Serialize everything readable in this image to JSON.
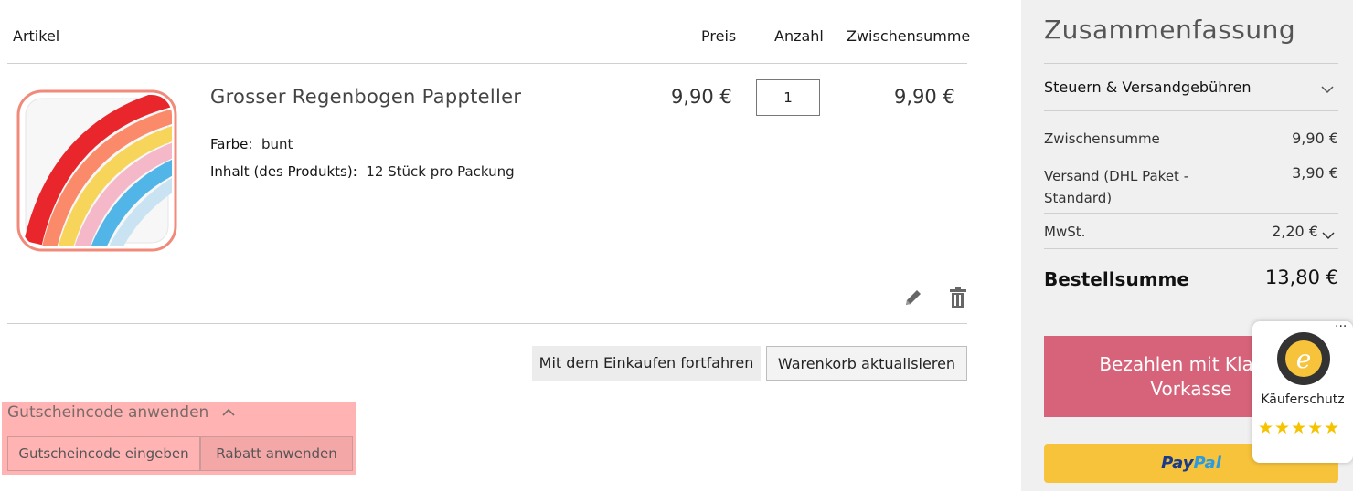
{
  "cart": {
    "headers": {
      "item": "Artikel",
      "price": "Preis",
      "qty": "Anzahl",
      "subtotal": "Zwischensumme"
    },
    "item": {
      "name": "Grosser Regenbogen Pappteller",
      "option1_label": "Farbe:",
      "option1_value": "bunt",
      "option2_label": "Inhalt (des Produkts):",
      "option2_value": "12 Stück pro Packung",
      "price": "9,90 €",
      "qty": "1",
      "subtotal": "9,90 €"
    },
    "continue_label": "Mit dem Einkaufen fortfahren",
    "update_label": "Warenkorb aktualisieren"
  },
  "coupon": {
    "title": "Gutscheincode anwenden",
    "input_placeholder": "Gutscheincode eingeben",
    "apply_label": "Rabatt anwenden"
  },
  "summary": {
    "title": "Zusammenfassung",
    "taxes_label": "Steuern & Versandgebühren",
    "subtotal_label": "Zwischensumme",
    "subtotal_value": "9,90 €",
    "shipping_label_line1": "Versand (DHL Paket -",
    "shipping_label_line2": "Standard)",
    "shipping_value": "3,90 €",
    "vat_label": "MwSt.",
    "vat_value": "2,20 €",
    "total_label": "Bestellsumme",
    "total_value": "13,80 €",
    "klarna_line1": "Bezahlen mit Klarna",
    "klarna_line2": "Vorkasse",
    "paypal_pay": "Pay",
    "paypal_pal": "Pal"
  },
  "trusted_shops": {
    "label": "Käuferschutz",
    "stars": "★★★★★",
    "menu": "···"
  },
  "colors": {
    "klarna": "#d7637a",
    "paypal": "#f7c33a",
    "coupon_highlight": "#ffb3b3"
  }
}
